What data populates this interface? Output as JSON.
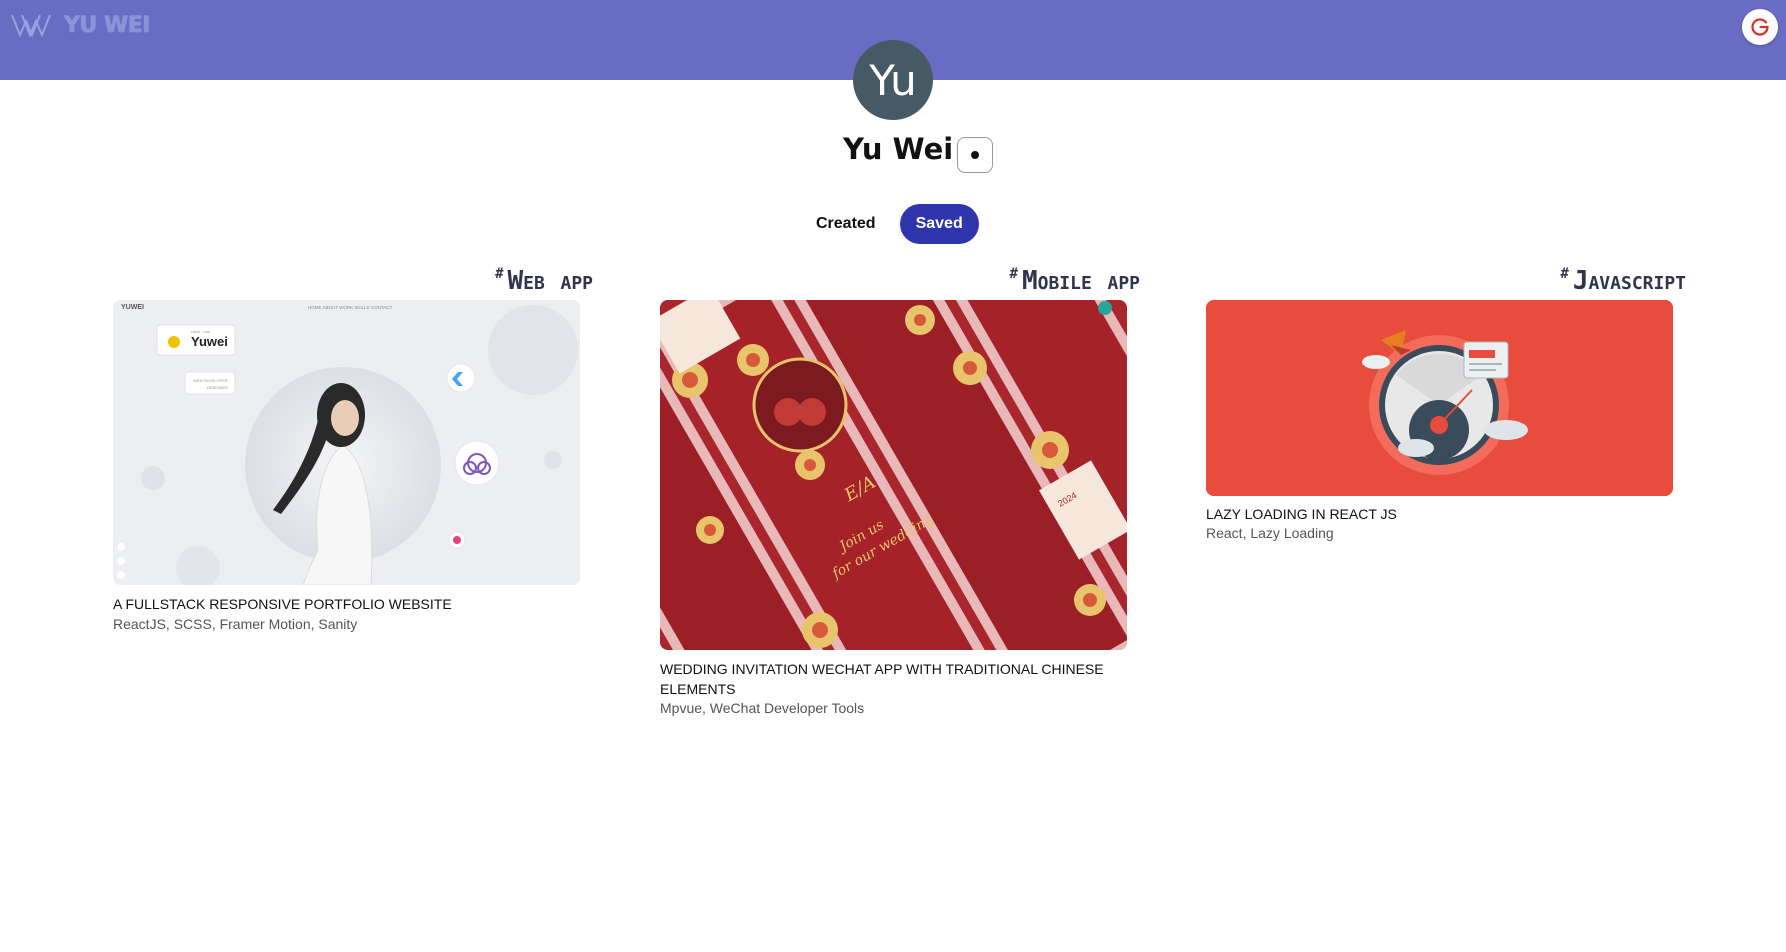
{
  "header": {
    "logo_text": "YU WEI",
    "logo_mark_icon": "w-monogram-icon",
    "logout_icon": "google-logout-icon"
  },
  "profile": {
    "avatar_initials": "Yu",
    "name": "Yu Wei",
    "more_button_icon": "dot-icon"
  },
  "tabs": [
    {
      "label": "Created",
      "active": false
    },
    {
      "label": "Saved",
      "active": true
    }
  ],
  "cards": [
    {
      "tag": "Web app",
      "title": "A FULLSTACK RESPONSIVE PORTFOLIO WEBSITE",
      "tech": "ReactJS, SCSS, Framer Motion, Sanity",
      "image_text": {
        "brand": "YUWEI",
        "nav": [
          "HOME",
          "ABOUT",
          "WORK",
          "SKILLS",
          "CONTACT"
        ],
        "greeting": "Hello, I am",
        "name": "Yuwei",
        "role": "WEB DEVELOPER\nDESIGNER"
      }
    },
    {
      "tag": "Mobile app",
      "title": "WEDDING INVITATION WECHAT APP WITH TRADITIONAL CHINESE ELEMENTS",
      "tech": "Mpvue, WeChat Developer Tools",
      "image_text": {
        "center": "Join us\nfor our wedding",
        "monogram": "E/A",
        "date": "2024"
      }
    },
    {
      "tag": "Javascript",
      "title": "LAZY LOADING IN REACT JS",
      "tech": "React, Lazy Loading",
      "image_text": {}
    }
  ],
  "colors": {
    "topbar": "#6a6cc4",
    "saved_tab": "#2e35ad",
    "avatar": "#455a64",
    "card3_bg": "#e74c3c"
  }
}
